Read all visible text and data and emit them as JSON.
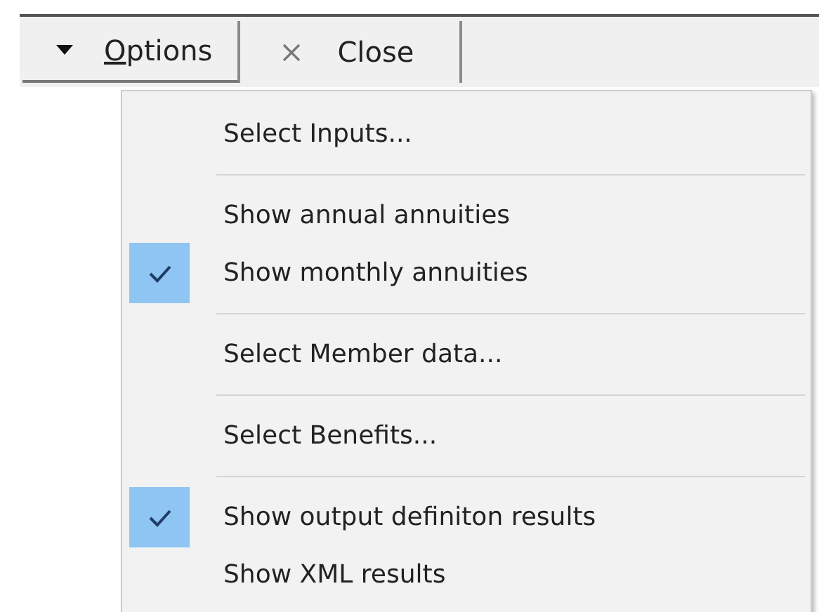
{
  "toolbar": {
    "buttons": [
      {
        "kind": "dropdown",
        "label": "Options",
        "pressed": true
      },
      {
        "kind": "close",
        "label": "Close",
        "pressed": false
      }
    ]
  },
  "menu": {
    "items": [
      {
        "kind": "item",
        "label": "Select Inputs...",
        "checked": false
      },
      {
        "kind": "separator"
      },
      {
        "kind": "item",
        "label": "Show annual annuities",
        "checked": false
      },
      {
        "kind": "item",
        "label": "Show monthly annuities",
        "checked": true
      },
      {
        "kind": "separator"
      },
      {
        "kind": "item",
        "label": "Select Member data...",
        "checked": false
      },
      {
        "kind": "separator"
      },
      {
        "kind": "item",
        "label": "Select Benefits...",
        "checked": false
      },
      {
        "kind": "separator"
      },
      {
        "kind": "item",
        "label": "Show output definiton results",
        "checked": true
      },
      {
        "kind": "item",
        "label": "Show XML results",
        "checked": false
      }
    ]
  }
}
